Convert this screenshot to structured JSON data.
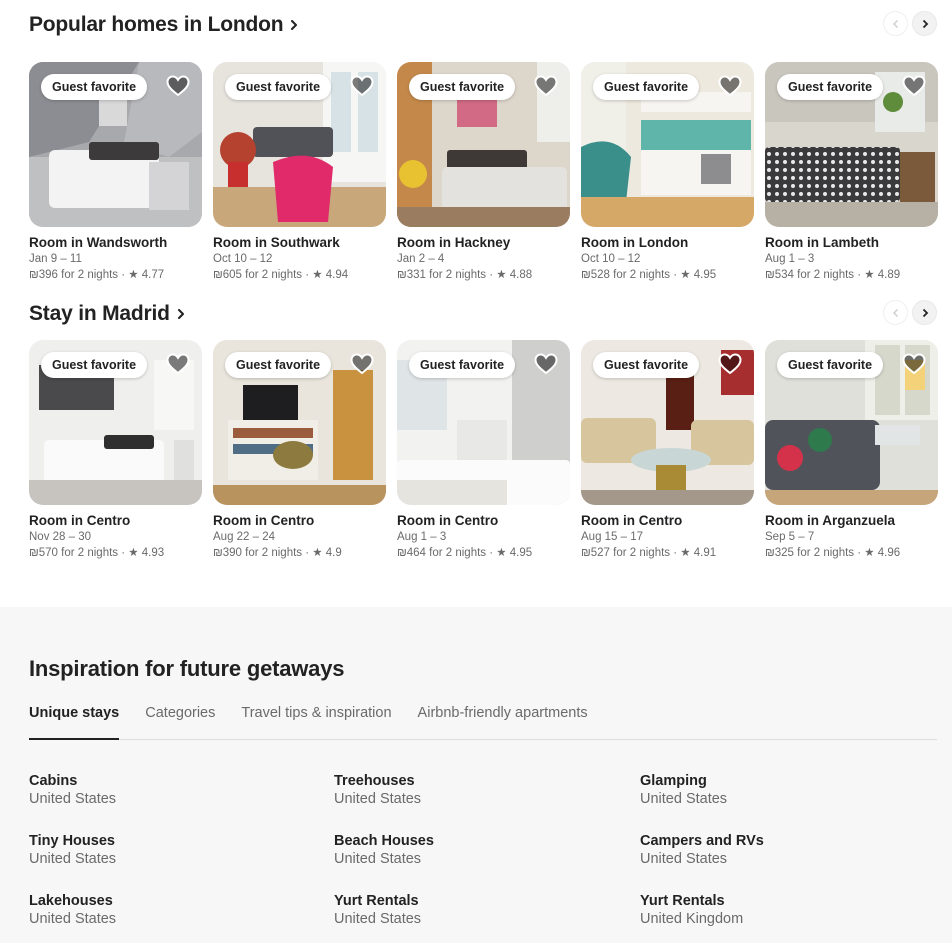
{
  "sections": [
    {
      "title": "Popular homes in London",
      "cards": [
        {
          "badge": "Guest favorite",
          "title": "Room in Wandsworth",
          "dates": "Jan 9 – 11",
          "meta": "₪396 for 2 nights · ★ 4.77"
        },
        {
          "badge": "Guest favorite",
          "title": "Room in Southwark",
          "dates": "Oct 10 – 12",
          "meta": "₪605 for 2 nights · ★ 4.94"
        },
        {
          "badge": "Guest favorite",
          "title": "Room in Hackney",
          "dates": "Jan 2 – 4",
          "meta": "₪331 for 2 nights · ★ 4.88"
        },
        {
          "badge": "Guest favorite",
          "title": "Room in London",
          "dates": "Oct 10 – 12",
          "meta": "₪528 for 2 nights · ★ 4.95"
        },
        {
          "badge": "Guest favorite",
          "title": "Room in Lambeth",
          "dates": "Aug 1 – 3",
          "meta": "₪534 for 2 nights · ★ 4.89"
        }
      ]
    },
    {
      "title": "Stay in Madrid",
      "cards": [
        {
          "badge": "Guest favorite",
          "title": "Room in Centro",
          "dates": "Nov 28 – 30",
          "meta": "₪570 for 2 nights · ★ 4.93"
        },
        {
          "badge": "Guest favorite",
          "title": "Room in Centro",
          "dates": "Aug 22 – 24",
          "meta": "₪390 for 2 nights · ★ 4.9"
        },
        {
          "badge": "Guest favorite",
          "title": "Room in Centro",
          "dates": "Aug 1 – 3",
          "meta": "₪464 for 2 nights · ★ 4.95"
        },
        {
          "badge": "Guest favorite",
          "title": "Room in Centro",
          "dates": "Aug 15 – 17",
          "meta": "₪527 for 2 nights · ★ 4.91"
        },
        {
          "badge": "Guest favorite",
          "title": "Room in Arganzuela",
          "dates": "Sep 5 – 7",
          "meta": "₪325 for 2 nights · ★ 4.96"
        }
      ]
    }
  ],
  "inspiration": {
    "title": "Inspiration for future getaways",
    "tabs": [
      "Unique stays",
      "Categories",
      "Travel tips & inspiration",
      "Airbnb-friendly apartments"
    ],
    "active_tab": "Unique stays",
    "items": [
      {
        "title": "Cabins",
        "subtitle": "United States"
      },
      {
        "title": "Treehouses",
        "subtitle": "United States"
      },
      {
        "title": "Glamping",
        "subtitle": "United States"
      },
      {
        "title": "Tiny Houses",
        "subtitle": "United States"
      },
      {
        "title": "Beach Houses",
        "subtitle": "United States"
      },
      {
        "title": "Campers and RVs",
        "subtitle": "United States"
      },
      {
        "title": "Lakehouses",
        "subtitle": "United States"
      },
      {
        "title": "Yurt Rentals",
        "subtitle": "United States"
      },
      {
        "title": "Yurt Rentals",
        "subtitle": "United Kingdom"
      }
    ]
  },
  "icons": {
    "section_chevron": "chevron-right-icon",
    "prev": "chevron-left-icon",
    "next": "chevron-right-icon",
    "wishlist": "heart-icon"
  },
  "colors": {
    "text": "#222222",
    "muted": "#6a6a6a",
    "panel": "#f7f7f7",
    "border": "#dddddd"
  }
}
